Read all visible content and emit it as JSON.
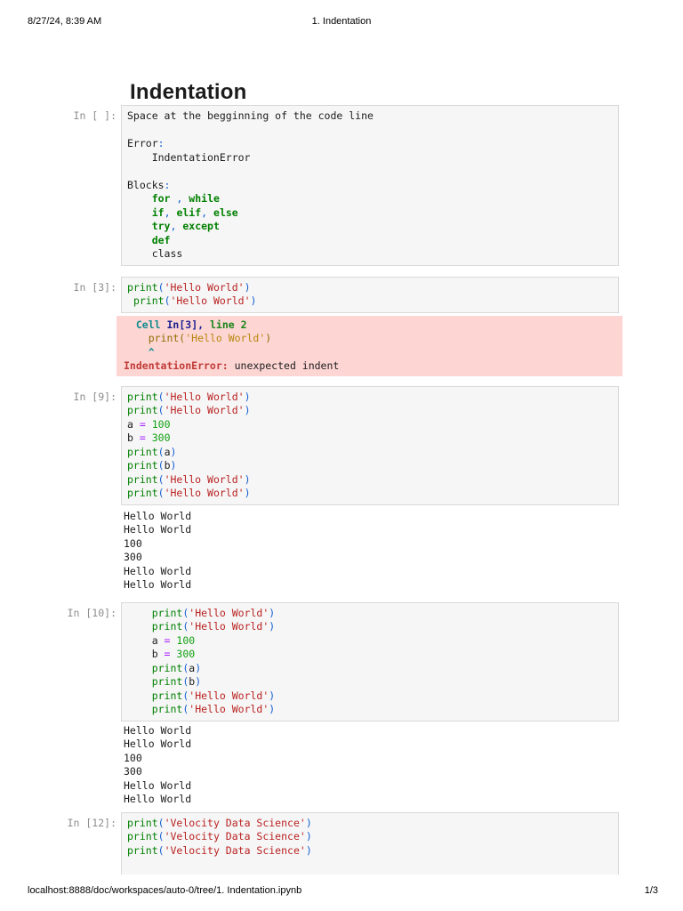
{
  "page": {
    "header": {
      "datetime": "8/27/24, 8:39 AM",
      "doc_title": "1. Indentation"
    },
    "footer": {
      "url": "localhost:8888/doc/workspaces/auto-0/tree/1. Indentation.ipynb",
      "page_number": "1/3"
    }
  },
  "notebook": {
    "title": "Indentation",
    "cells": [
      {
        "type": "code",
        "prompt": "In [ ]:",
        "spacing": "",
        "lines": [
          [
            {
              "c": "tx",
              "s": "Space at the begginning of the code line"
            }
          ],
          [],
          [
            {
              "c": "tx",
              "s": "Error"
            },
            {
              "c": "pu",
              "s": ":"
            }
          ],
          [
            {
              "c": "tx",
              "s": "    IndentationError"
            }
          ],
          [],
          [
            {
              "c": "tx",
              "s": "Blocks"
            },
            {
              "c": "pu",
              "s": ":"
            }
          ],
          [
            {
              "c": "tx",
              "s": "    "
            },
            {
              "c": "kw",
              "s": "for"
            },
            {
              "c": "tx",
              "s": " "
            },
            {
              "c": "pu",
              "s": ","
            },
            {
              "c": "tx",
              "s": " "
            },
            {
              "c": "kw",
              "s": "while"
            }
          ],
          [
            {
              "c": "tx",
              "s": "    "
            },
            {
              "c": "kw",
              "s": "if"
            },
            {
              "c": "pu",
              "s": ","
            },
            {
              "c": "tx",
              "s": " "
            },
            {
              "c": "kw",
              "s": "elif"
            },
            {
              "c": "pu",
              "s": ","
            },
            {
              "c": "tx",
              "s": " "
            },
            {
              "c": "kw",
              "s": "else"
            }
          ],
          [
            {
              "c": "tx",
              "s": "    "
            },
            {
              "c": "kw",
              "s": "try"
            },
            {
              "c": "pu",
              "s": ","
            },
            {
              "c": "tx",
              "s": " "
            },
            {
              "c": "kw",
              "s": "except"
            }
          ],
          [
            {
              "c": "tx",
              "s": "    "
            },
            {
              "c": "kw",
              "s": "def"
            }
          ],
          [
            {
              "c": "tx",
              "s": "    class"
            }
          ]
        ]
      },
      {
        "type": "code",
        "prompt": "In [3]:",
        "spacing": "m12",
        "lines": [
          [
            {
              "c": "bi",
              "s": "print"
            },
            {
              "c": "pu",
              "s": "("
            },
            {
              "c": "st",
              "s": "'Hello World'"
            },
            {
              "c": "pu",
              "s": ")"
            }
          ],
          [
            {
              "c": "tx",
              "s": " "
            },
            {
              "c": "bi",
              "s": "print"
            },
            {
              "c": "pu",
              "s": "("
            },
            {
              "c": "st",
              "s": "'Hello World'"
            },
            {
              "c": "pu",
              "s": ")"
            }
          ]
        ]
      },
      {
        "type": "error",
        "spacing": "m3",
        "lines": [
          [
            {
              "c": "tx",
              "s": "  "
            },
            {
              "c": "ec",
              "s": "Cell"
            },
            {
              "c": "tx",
              "s": " "
            },
            {
              "c": "en",
              "s": "In[3],"
            },
            {
              "c": "tx",
              "s": " "
            },
            {
              "c": "eg",
              "s": "line 2"
            }
          ],
          [
            {
              "c": "ey",
              "s": "    print("
            },
            {
              "c": "es",
              "s": "'Hello World'"
            },
            {
              "c": "ey",
              "s": ")"
            }
          ],
          [
            {
              "c": "ec",
              "s": "    ^"
            }
          ],
          [
            {
              "c": "er",
              "s": "IndentationError:"
            },
            {
              "c": "tx",
              "s": " unexpected indent"
            }
          ]
        ]
      },
      {
        "type": "code",
        "prompt": "In [9]:",
        "spacing": "m11",
        "lines": [
          [
            {
              "c": "bi",
              "s": "print"
            },
            {
              "c": "pu",
              "s": "("
            },
            {
              "c": "st",
              "s": "'Hello World'"
            },
            {
              "c": "pu",
              "s": ")"
            }
          ],
          [
            {
              "c": "bi",
              "s": "print"
            },
            {
              "c": "pu",
              "s": "("
            },
            {
              "c": "st",
              "s": "'Hello World'"
            },
            {
              "c": "pu",
              "s": ")"
            }
          ],
          [
            {
              "c": "tx",
              "s": "a "
            },
            {
              "c": "op",
              "s": "="
            },
            {
              "c": "tx",
              "s": " "
            },
            {
              "c": "nu",
              "s": "100"
            }
          ],
          [
            {
              "c": "tx",
              "s": "b "
            },
            {
              "c": "op",
              "s": "="
            },
            {
              "c": "tx",
              "s": " "
            },
            {
              "c": "nu",
              "s": "300"
            }
          ],
          [
            {
              "c": "bi",
              "s": "print"
            },
            {
              "c": "pu",
              "s": "("
            },
            {
              "c": "tx",
              "s": "a"
            },
            {
              "c": "pu",
              "s": ")"
            }
          ],
          [
            {
              "c": "bi",
              "s": "print"
            },
            {
              "c": "pu",
              "s": "("
            },
            {
              "c": "tx",
              "s": "b"
            },
            {
              "c": "pu",
              "s": ")"
            }
          ],
          [
            {
              "c": "bi",
              "s": "print"
            },
            {
              "c": "pu",
              "s": "("
            },
            {
              "c": "st",
              "s": "'Hello World'"
            },
            {
              "c": "pu",
              "s": ")"
            }
          ],
          [
            {
              "c": "bi",
              "s": "print"
            },
            {
              "c": "pu",
              "s": "("
            },
            {
              "c": "st",
              "s": "'Hello World'"
            },
            {
              "c": "pu",
              "s": ")"
            }
          ]
        ]
      },
      {
        "type": "output",
        "spacing": "m5",
        "text_lines": [
          "Hello World",
          "Hello World",
          "100",
          "300",
          "Hello World",
          "Hello World"
        ]
      },
      {
        "type": "code",
        "prompt": "In [10]:",
        "spacing": "m11",
        "lines": [
          [
            {
              "c": "tx",
              "s": "    "
            },
            {
              "c": "bi",
              "s": "print"
            },
            {
              "c": "pu",
              "s": "("
            },
            {
              "c": "st",
              "s": "'Hello World'"
            },
            {
              "c": "pu",
              "s": ")"
            }
          ],
          [
            {
              "c": "tx",
              "s": "    "
            },
            {
              "c": "bi",
              "s": "print"
            },
            {
              "c": "pu",
              "s": "("
            },
            {
              "c": "st",
              "s": "'Hello World'"
            },
            {
              "c": "pu",
              "s": ")"
            }
          ],
          [
            {
              "c": "tx",
              "s": "    a "
            },
            {
              "c": "op",
              "s": "="
            },
            {
              "c": "tx",
              "s": " "
            },
            {
              "c": "nu",
              "s": "100"
            }
          ],
          [
            {
              "c": "tx",
              "s": "    b "
            },
            {
              "c": "op",
              "s": "="
            },
            {
              "c": "tx",
              "s": " "
            },
            {
              "c": "nu",
              "s": "300"
            }
          ],
          [
            {
              "c": "tx",
              "s": "    "
            },
            {
              "c": "bi",
              "s": "print"
            },
            {
              "c": "pu",
              "s": "("
            },
            {
              "c": "tx",
              "s": "a"
            },
            {
              "c": "pu",
              "s": ")"
            }
          ],
          [
            {
              "c": "tx",
              "s": "    "
            },
            {
              "c": "bi",
              "s": "print"
            },
            {
              "c": "pu",
              "s": "("
            },
            {
              "c": "tx",
              "s": "b"
            },
            {
              "c": "pu",
              "s": ")"
            }
          ],
          [
            {
              "c": "tx",
              "s": "    "
            },
            {
              "c": "bi",
              "s": "print"
            },
            {
              "c": "pu",
              "s": "("
            },
            {
              "c": "st",
              "s": "'Hello World'"
            },
            {
              "c": "pu",
              "s": ")"
            }
          ],
          [
            {
              "c": "tx",
              "s": "    "
            },
            {
              "c": "bi",
              "s": "print"
            },
            {
              "c": "pu",
              "s": "("
            },
            {
              "c": "st",
              "s": "'Hello World'"
            },
            {
              "c": "pu",
              "s": ")"
            }
          ]
        ]
      },
      {
        "type": "output",
        "spacing": "m3",
        "text_lines": [
          "Hello World",
          "Hello World",
          "100",
          "300",
          "Hello World",
          "Hello World"
        ]
      },
      {
        "type": "code",
        "prompt": "In [12]:",
        "spacing": "m6",
        "clipped": true,
        "lines": [
          [
            {
              "c": "bi",
              "s": "print"
            },
            {
              "c": "pu",
              "s": "("
            },
            {
              "c": "st",
              "s": "'Velocity Data Science'"
            },
            {
              "c": "pu",
              "s": ")"
            }
          ],
          [
            {
              "c": "bi",
              "s": "print"
            },
            {
              "c": "pu",
              "s": "("
            },
            {
              "c": "st",
              "s": "'Velocity Data Science'"
            },
            {
              "c": "pu",
              "s": ")"
            }
          ],
          [
            {
              "c": "bi",
              "s": "print"
            },
            {
              "c": "pu",
              "s": "("
            },
            {
              "c": "st",
              "s": "'Velocity Data Science'"
            },
            {
              "c": "pu",
              "s": ")"
            }
          ]
        ]
      }
    ]
  },
  "colors": {
    "cell_background": "#f6f6f6",
    "cell_border": "#d9d9d9",
    "error_background": "#fdd6d4",
    "prompt_gray": "#8d8d8d",
    "keyword_green": "#008000",
    "string_red": "#ba2121",
    "number_green": "#11a211",
    "operator_purple": "#aa22ff",
    "punctuation_blue": "#1560d0",
    "traceback_cyan": "#0e8a90",
    "traceback_navy": "#191e8f",
    "traceback_gold": "#8f6c00",
    "error_name_red": "#c03a36"
  }
}
